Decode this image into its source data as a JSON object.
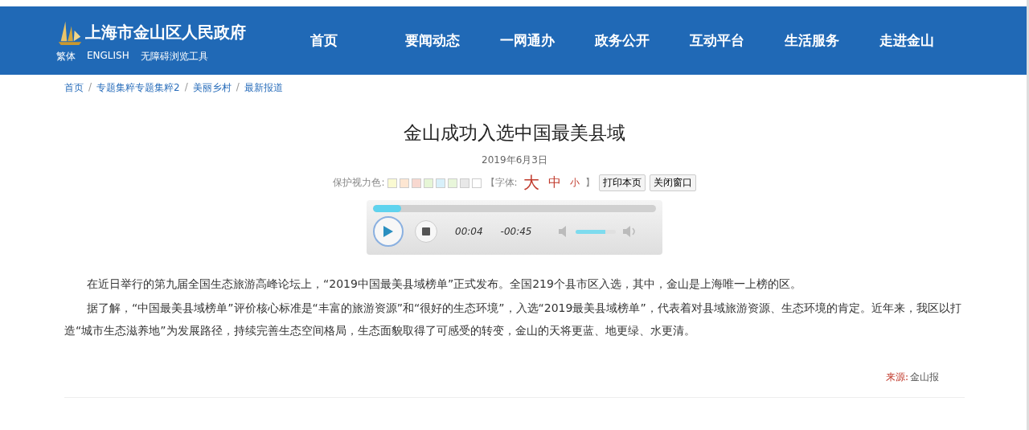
{
  "header": {
    "site_title": "上海市金山区人民政府",
    "links": [
      "繁体",
      "ENGLISH",
      "无障碍浏览工具"
    ],
    "nav": [
      {
        "label": "首页"
      },
      {
        "label": "要闻动态"
      },
      {
        "label": "一网通办"
      },
      {
        "label": "政务公开"
      },
      {
        "label": "互动平台"
      },
      {
        "label": "生活服务"
      },
      {
        "label": "走进金山"
      }
    ]
  },
  "breadcrumb": {
    "separator": "/",
    "items": [
      "首页",
      "专题集粹专题集粹2",
      "美丽乡村",
      "最新报道"
    ]
  },
  "article": {
    "title": "金山成功入选中国最美县域",
    "date": "2019年6月3日",
    "tools": {
      "eye_color_label": "保护视力色:",
      "swatches": [
        {
          "color": "#fafad2"
        },
        {
          "color": "#fde6d2"
        },
        {
          "color": "#f8d8d0"
        },
        {
          "color": "#e6f6d6"
        },
        {
          "color": "#d8f0fa"
        },
        {
          "color": "#e8f6da"
        },
        {
          "color": "#e8e8e8"
        },
        {
          "color": "#ffffff"
        }
      ],
      "font_label": "【字体:",
      "font_sizes": [
        "大",
        "中",
        "小"
      ],
      "font_close": "】",
      "buttons": [
        "打印本页",
        "关闭窗口"
      ]
    },
    "player": {
      "progress": {
        "level": 0.1
      },
      "elapsed": "00:04",
      "remaining": "-00:45",
      "volume": {
        "level": 0.75
      }
    },
    "paragraphs": [
      "在近日举行的第九届全国生态旅游高峰论坛上，“2019中国最美县域榜单”正式发布。全国219个县市区入选，其中，金山是上海唯一上榜的区。",
      "据了解，“中国最美县域榜单”评价核心标准是“丰富的旅游资源”和“很好的生态环境”，入选“2019最美县域榜单”，代表着对县域旅游资源、生态环境的肯定。近年来，我区以打造“城市生态滋养地”为发展路径，持续完善生态空间格局，生态面貌取得了可感受的转变，金山的天将更蓝、地更绿、水更清。"
    ],
    "source_label": "来源:",
    "source": "金山报"
  }
}
